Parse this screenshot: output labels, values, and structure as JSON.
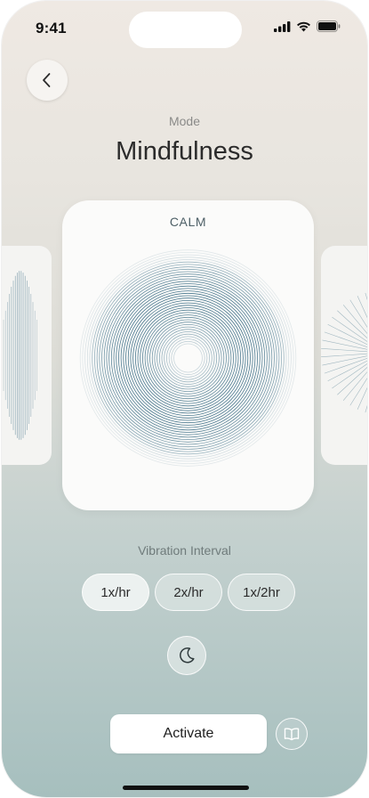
{
  "status_bar": {
    "time": "9:41",
    "icons": [
      "signal-icon",
      "wifi-icon",
      "battery-icon"
    ]
  },
  "header": {
    "back_icon": "chevron-left-icon",
    "mode_label": "Mode",
    "mode_title": "Mindfulness"
  },
  "mode_card": {
    "label": "CALM",
    "pattern": "concentric-rings",
    "ring_color": "#3e6f86"
  },
  "interval": {
    "label": "Vibration Interval",
    "options": [
      "1x/hr",
      "2x/hr",
      "1x/2hr"
    ],
    "selected": "1x/hr"
  },
  "night_mode_icon": "moon-icon",
  "actions": {
    "activate_label": "Activate",
    "guide_icon": "book-icon"
  },
  "colors": {
    "background_top": "#efe9e3",
    "background_bottom": "#a6bfbe",
    "card": "#fbfbfa",
    "text_primary": "#2b2b2b"
  }
}
